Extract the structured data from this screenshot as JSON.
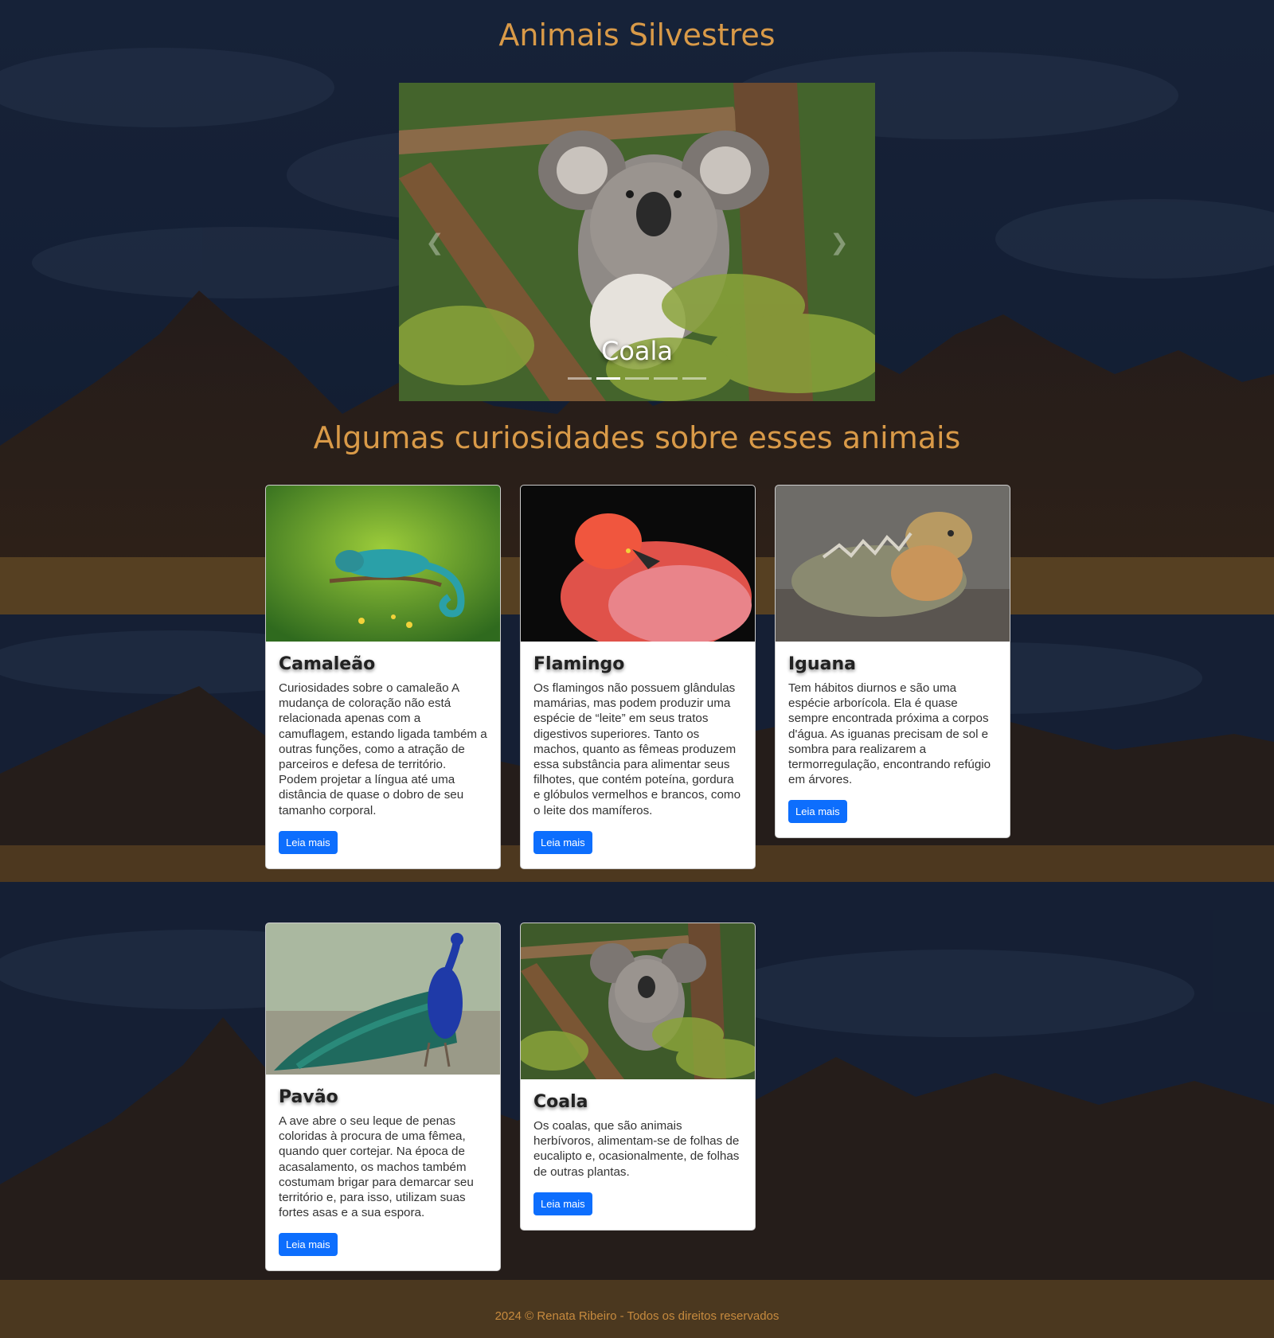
{
  "site": {
    "title": "Animais Silvestres"
  },
  "carousel": {
    "caption": "Coala",
    "prev_icon": "chevron-left-icon",
    "next_icon": "chevron-right-icon",
    "slide_count": 5,
    "active_index": 1
  },
  "section": {
    "title": "Algumas curiosidades sobre esses animais"
  },
  "cards": [
    {
      "title": "Camaleão",
      "text": "Curiosidades sobre o camaleão A mudança de coloração não está relacionada apenas com a camuflagem, estando ligada também a outras funções, como a atração de parceiros e defesa de território. Podem projetar a língua até uma distância de quase o dobro de seu tamanho corporal.",
      "button": "Leia mais"
    },
    {
      "title": "Flamingo",
      "text": "Os flamingos não possuem glândulas mamárias, mas podem produzir uma espécie de “leite” em seus tratos digestivos superiores. Tanto os machos, quanto as fêmeas produzem essa substância para alimentar seus filhotes, que contém poteína, gordura e glóbulos vermelhos e brancos, como o leite dos mamíferos.",
      "button": "Leia mais"
    },
    {
      "title": "Iguana",
      "text": "Tem hábitos diurnos e são uma espécie arborícola. Ela é quase sempre encontrada próxima a corpos d'água. As iguanas precisam de sol e sombra para realizarem a termorregulação, encontrando refúgio em árvores.",
      "button": "Leia mais"
    },
    {
      "title": "Pavão",
      "text": "A ave abre o seu leque de penas coloridas à procura de uma fêmea, quando quer cortejar. Na época de acasalamento, os machos também costumam brigar para demarcar seu território e, para isso, utilizam suas fortes asas e a sua espora.",
      "button": "Leia mais"
    },
    {
      "title": "Coala",
      "text": "Os coalas, que são animais herbívoros, alimentam-se de folhas de eucalipto e, ocasionalmente, de folhas de outras plantas.",
      "button": "Leia mais"
    }
  ],
  "footer": {
    "text": "2024 © Renata Ribeiro - Todos os direitos reservados"
  },
  "colors": {
    "heading": "#d99a48",
    "button": "#0d6efd",
    "footer": "#c68a3e"
  }
}
